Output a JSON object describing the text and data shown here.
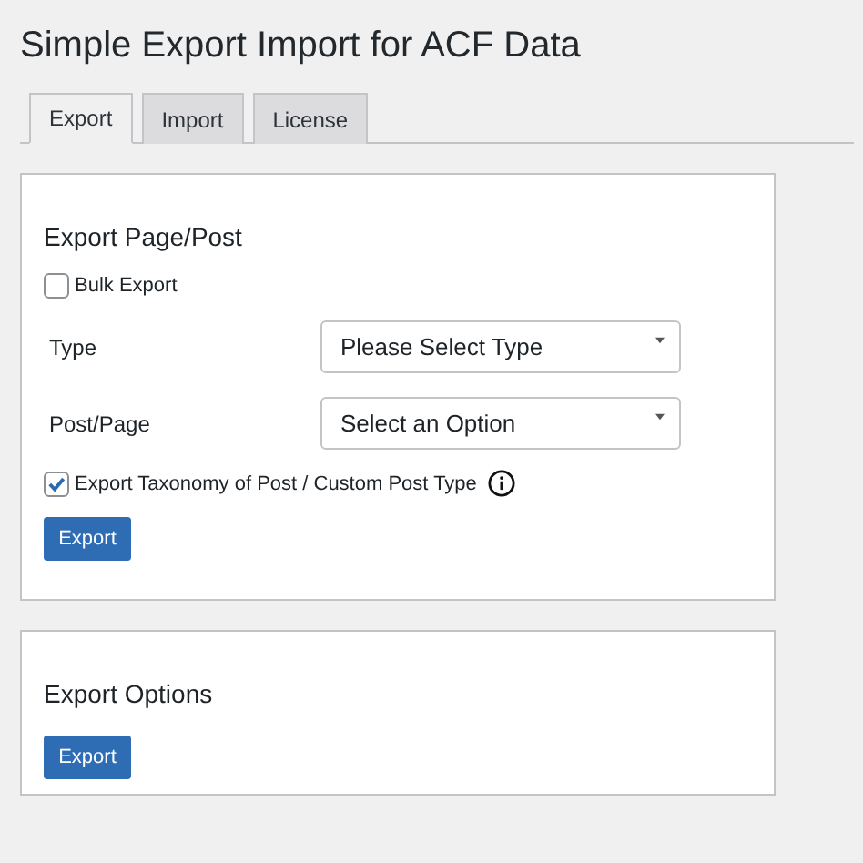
{
  "page_title": "Simple Export Import for ACF Data",
  "tabs": [
    {
      "label": "Export",
      "selected": true
    },
    {
      "label": "Import",
      "selected": false
    },
    {
      "label": "License",
      "selected": false
    }
  ],
  "export_panel": {
    "heading": "Export Page/Post",
    "bulk_export": {
      "label": "Bulk Export",
      "checked": false
    },
    "fields": [
      {
        "label": "Type",
        "value": "Please Select Type"
      },
      {
        "label": "Post/Page",
        "value": "Select an Option"
      }
    ],
    "taxonomy": {
      "label": "Export Taxonomy of Post / Custom Post Type",
      "checked": true
    },
    "button": "Export"
  },
  "options_panel": {
    "heading": "Export Options",
    "button": "Export"
  }
}
